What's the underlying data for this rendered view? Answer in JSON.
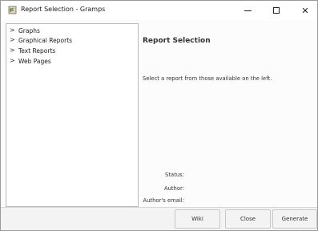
{
  "window": {
    "title": "Report Selection - Gramps"
  },
  "tree": {
    "items": [
      {
        "label": "Graphs"
      },
      {
        "label": "Graphical Reports"
      },
      {
        "label": "Text Reports"
      },
      {
        "label": "Web Pages"
      }
    ]
  },
  "details": {
    "heading": "Report Selection",
    "description": "Select a report from those available on the left.",
    "status_label": "Status:",
    "author_label": "Author:",
    "email_label": "Author's email:"
  },
  "buttons": {
    "wiki": "Wiki",
    "close": "Close",
    "generate": "Generate"
  },
  "icons": {
    "window_controls": [
      "minimize-icon",
      "maximize-icon",
      "close-icon"
    ],
    "tree_expander": "chevron-right-icon"
  }
}
